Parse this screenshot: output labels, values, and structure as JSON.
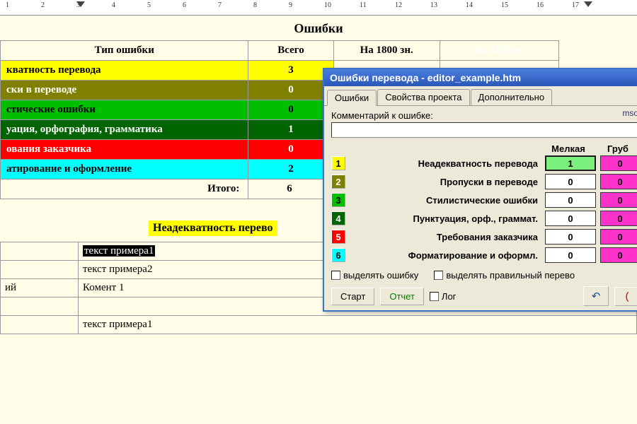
{
  "ruler": {
    "numbers": [
      1,
      2,
      3,
      4,
      5,
      6,
      7,
      8,
      9,
      10,
      11,
      12,
      13,
      14,
      15,
      16,
      17
    ]
  },
  "doc": {
    "heading": "Ошибки",
    "columns": {
      "type": "Тип ошибки",
      "total": "Всего",
      "per1": "На 1800 зн.",
      "per2": "На 1800 зн"
    },
    "rows": [
      {
        "label": "кватность перевода",
        "count": 3,
        "cls": "yellow"
      },
      {
        "label": "ски в переводе",
        "count": 0,
        "cls": "olive"
      },
      {
        "label": "стические ошибки",
        "count": 0,
        "cls": "green"
      },
      {
        "label": "уация, орфография, грамматика",
        "count": 1,
        "cls": "darkgreen"
      },
      {
        "label": "ования заказчика",
        "count": 0,
        "cls": "red"
      },
      {
        "label": "атирование и оформление",
        "count": 2,
        "cls": "cyan"
      }
    ],
    "total_label": "Итого:",
    "total_value": 6,
    "sub_heading": "Неадекватность перево",
    "detail_rows": [
      {
        "left": "",
        "right": "текст примера1",
        "hilite": true
      },
      {
        "left": "",
        "right": "текст примера2",
        "hilite": false
      },
      {
        "left": "ий",
        "right": "Комент 1",
        "hilite": false
      },
      {
        "left": "",
        "right": "",
        "hilite": false
      },
      {
        "left": "",
        "right": "текст примера1",
        "hilite": false
      }
    ]
  },
  "dialog": {
    "title": "Ошибки перевода - editor_example.htm",
    "tabs": {
      "t1": "Ошибки",
      "t2": "Свойства проекта",
      "t3": "Дополнительно"
    },
    "mso": "mso-",
    "comment_label": "Комментарий к ошибке:",
    "comment_value": "",
    "col_minor": "Мелкая",
    "col_gross": "Груб",
    "categories": [
      {
        "n": "1",
        "name": "Неадекватность перевода",
        "minor": "1",
        "gross": "0",
        "cls": "yellow",
        "active": true
      },
      {
        "n": "2",
        "name": "Пропуски в переводе",
        "minor": "0",
        "gross": "0",
        "cls": "olive"
      },
      {
        "n": "3",
        "name": "Стилистические ошибки",
        "minor": "0",
        "gross": "0",
        "cls": "green"
      },
      {
        "n": "4",
        "name": "Пунктуация, орф., граммат.",
        "minor": "0",
        "gross": "0",
        "cls": "darkgreen"
      },
      {
        "n": "5",
        "name": "Требования заказчика",
        "minor": "0",
        "gross": "0",
        "cls": "red"
      },
      {
        "n": "6",
        "name": "Форматирование и оформл.",
        "minor": "0",
        "gross": "0",
        "cls": "cyan"
      }
    ],
    "check1": "выделять ошибку",
    "check2": "выделять правильный перево",
    "btn_start": "Старт",
    "btn_report": "Отчет",
    "check_log": "Лог",
    "undo": "↶",
    "redo": "("
  }
}
